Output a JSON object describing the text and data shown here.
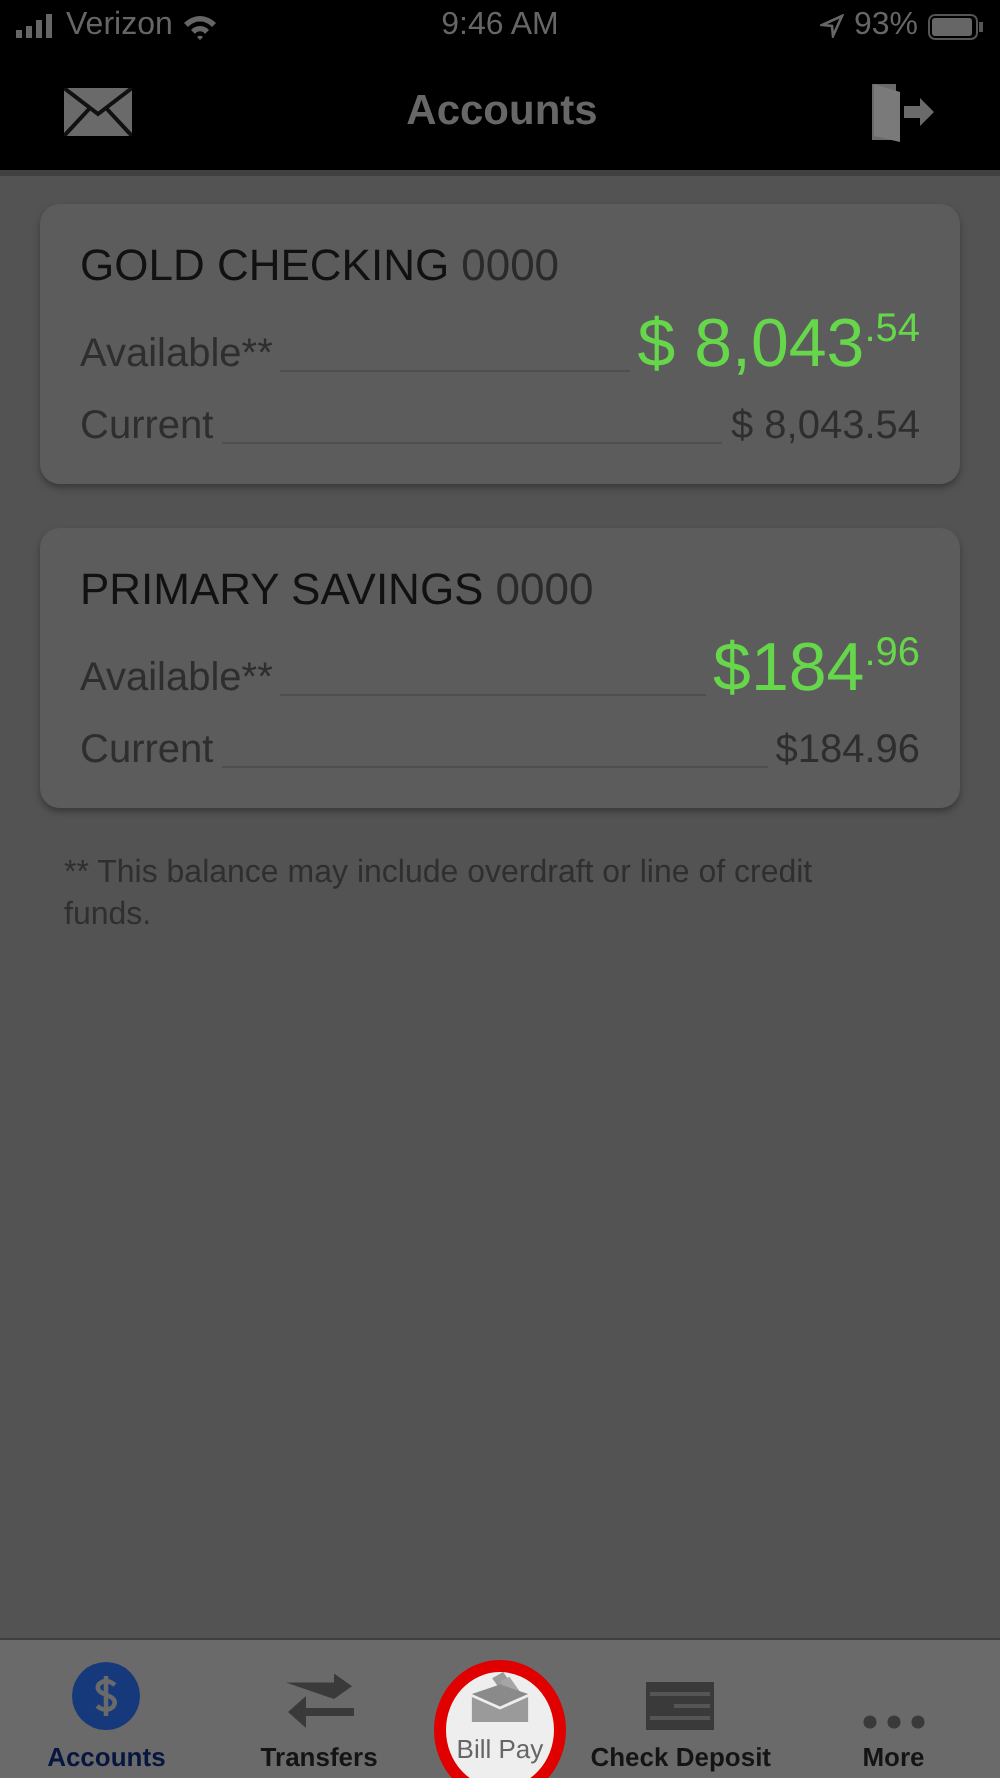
{
  "status_bar": {
    "carrier": "Verizon",
    "time": "9:46 AM",
    "battery": "93%"
  },
  "header": {
    "title": "Accounts"
  },
  "accounts": [
    {
      "name": "GOLD CHECKING",
      "number": "0000",
      "available_label": "Available**",
      "available": "$ 8,043$^{.54}$",
      "current_label": "Current",
      "current": "$ 8,043.54"
    },
    {
      "name": "PRIMARY SAVINGS",
      "number": "0000",
      "available_label": "Available**",
      "available": "$184$^{.96}$",
      "current_label": "Current",
      "current": "$184.96"
    }
  ],
  "footnote": "** This balance may include overdraft or line of credit funds.",
  "tabs": [
    {
      "label": "Accounts",
      "kind": "dollar",
      "selected": true,
      "highlighted": false
    },
    {
      "label": "Transfers",
      "kind": "arrows",
      "selected": false,
      "highlighted": false
    },
    {
      "label": "Bill Pay",
      "kind": "envelope",
      "selected": false,
      "highlighted": true
    },
    {
      "label": "Check Deposit",
      "kind": "check",
      "selected": false,
      "highlighted": false
    },
    {
      "label": "More",
      "kind": "dots",
      "selected": false,
      "highlighted": false
    }
  ]
}
